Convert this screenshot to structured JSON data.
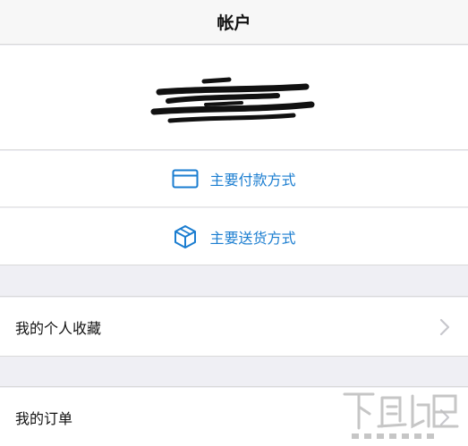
{
  "nav": {
    "title": "帐户"
  },
  "account": {
    "name_redacted": true
  },
  "actions": {
    "payment_label": "主要付款方式",
    "shipping_label": "主要送货方式"
  },
  "list": {
    "favorites_label": "我的个人收藏",
    "orders_label": "我的订单"
  },
  "colors": {
    "accent": "#1a7dd0",
    "background": "#efeff4"
  },
  "icons": {
    "payment": "credit-card-icon",
    "shipping": "package-box-icon",
    "disclosure": "chevron-right-icon"
  },
  "watermark": {
    "present": true
  }
}
